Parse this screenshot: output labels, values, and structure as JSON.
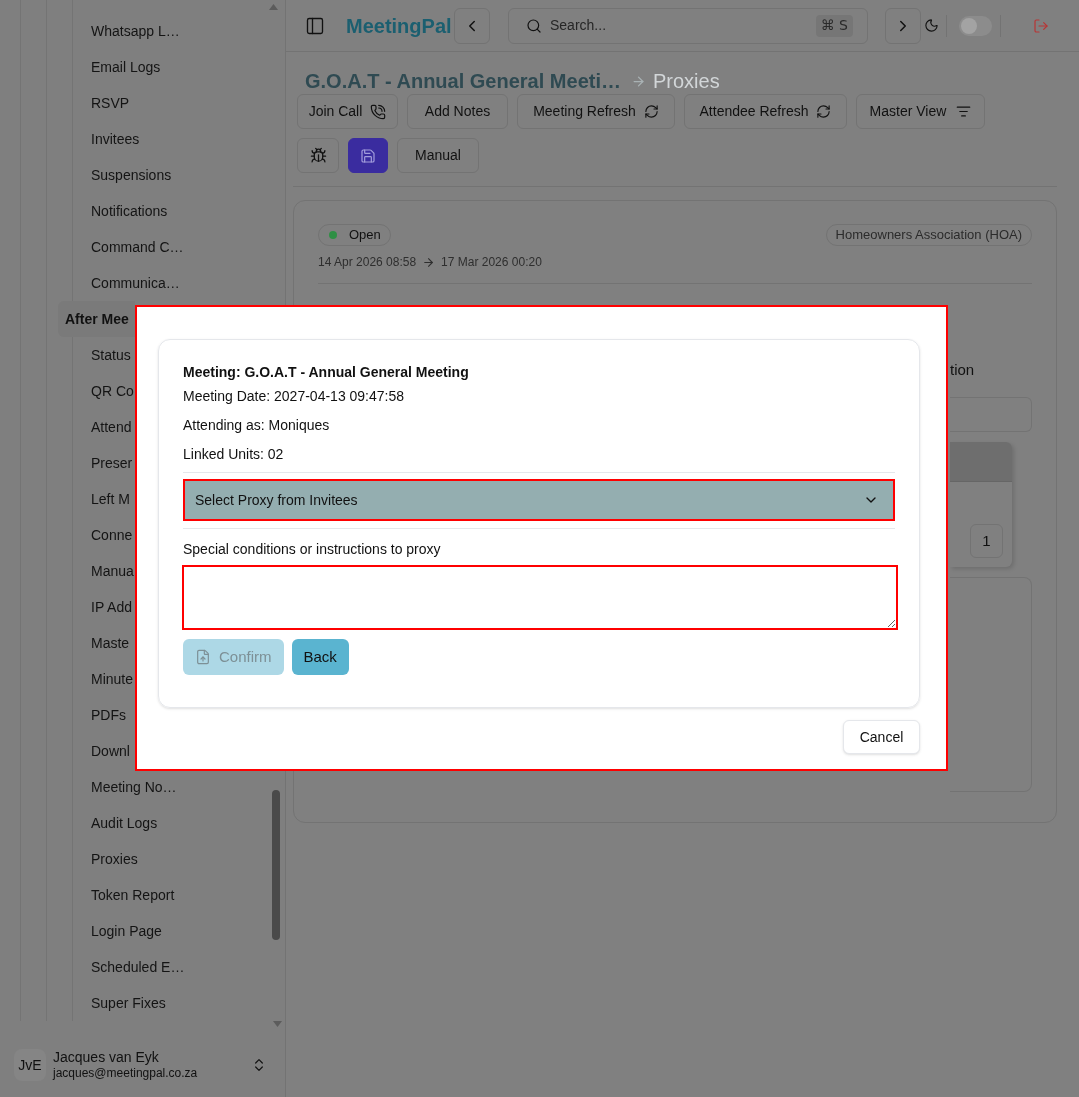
{
  "sidebar": {
    "groups": [
      {
        "items": [
          "Whatsapp L…",
          "Email Logs",
          "RSVP",
          "Invitees",
          "Suspensions",
          "Notifications",
          "Command C…",
          "Communica…"
        ]
      },
      {
        "label": "After Mee",
        "items": [
          "Status",
          "QR Co",
          "Attend",
          "Preser",
          "Left M",
          "Conne",
          "Manua",
          "IP Add",
          "Maste",
          "Minute",
          "PDFs",
          "Downl",
          "Meeting No…",
          "Audit Logs",
          "Proxies",
          "Token Report",
          "Login Page",
          "Scheduled E…",
          "Super Fixes"
        ]
      }
    ],
    "user": {
      "initials": "JvE",
      "name": "Jacques van Eyk",
      "email": "jacques@meetingpal.co.za"
    }
  },
  "topbar": {
    "logo": "MeetingPal",
    "search": {
      "placeholder": "Search...",
      "shortcut": "⌘ S"
    },
    "theme_toggle": {
      "on": false
    }
  },
  "breadcrumb": {
    "title": "G.O.A.T - Annual General Meeti…",
    "current": "Proxies"
  },
  "actions": [
    [
      {
        "kind": "call",
        "label": "Join Call"
      },
      {
        "kind": "plain",
        "label": "Add Notes"
      },
      {
        "kind": "refresh",
        "label": "Meeting Refresh"
      },
      {
        "kind": "refresh",
        "label": "Attendee Refresh"
      },
      {
        "kind": "view",
        "label": "Master View"
      }
    ],
    [
      {
        "kind": "debug"
      },
      {
        "kind": "save"
      },
      {
        "kind": "plain",
        "label": "Manual"
      }
    ]
  ],
  "meeting_card": {
    "status": "Open",
    "category": "Homeowners Association (HOA)",
    "start": "14 Apr 2026 08:58",
    "end": "17 Mar 2026 00:20",
    "field_label": "tion",
    "pages": [
      "1"
    ]
  },
  "dialog": {
    "title": "Meeting: G.O.A.T - Annual General Meeting",
    "details": [
      "Meeting Date: 2027-04-13 09:47:58",
      "Attending as: Moniques",
      "Linked Units: 02"
    ],
    "proxy_select": {
      "placeholder": "Select Proxy from Invitees"
    },
    "instructions": {
      "label": "Special conditions or instructions to proxy"
    },
    "buttons": [
      {
        "kind": "confirm",
        "label": "Confirm",
        "disabled": true
      },
      {
        "kind": "back",
        "label": "Back",
        "disabled": false
      }
    ],
    "cancel": "Cancel"
  }
}
